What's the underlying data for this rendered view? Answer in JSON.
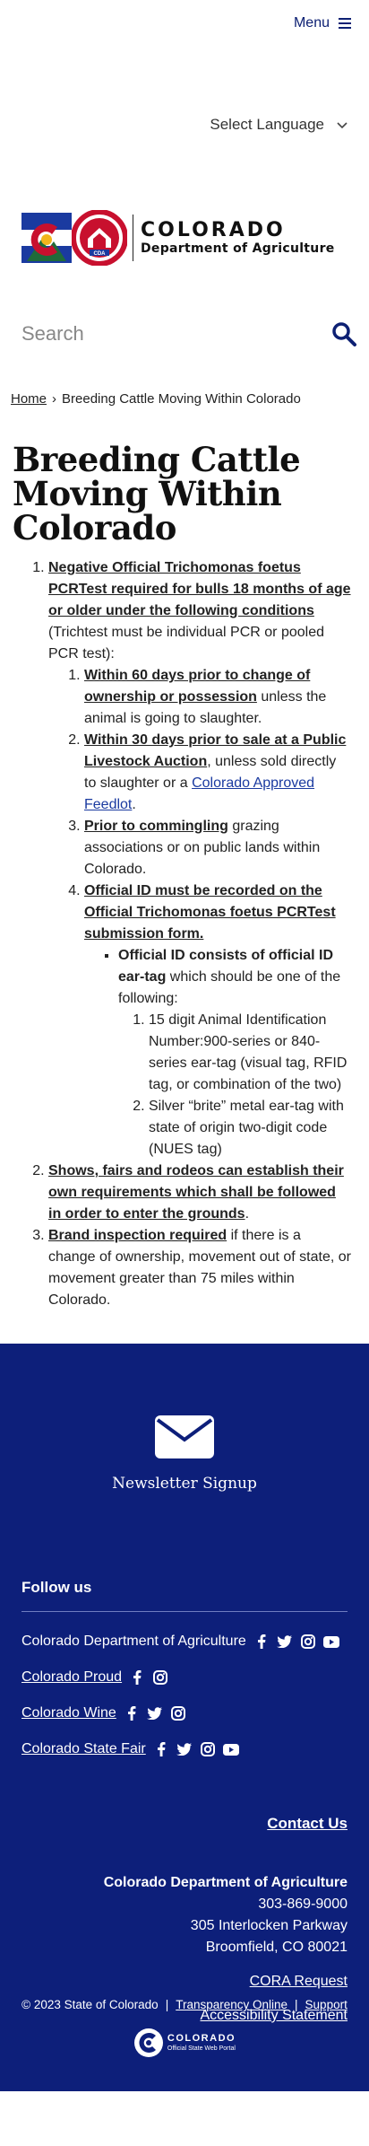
{
  "header": {
    "menu_label": "Menu",
    "language_label": "Select Language"
  },
  "logo": {
    "state": "COLORADO",
    "department": "Department of Agriculture",
    "badge": "CDA"
  },
  "search": {
    "placeholder": "Search"
  },
  "breadcrumb": {
    "home": "Home",
    "separator": "›",
    "current": "Breeding Cattle Moving Within Colorado"
  },
  "page": {
    "title": "Breeding Cattle Moving Within Colorado"
  },
  "content": {
    "item1": {
      "bold": "Negative Official Trichomonas foetus PCRTest required for bulls 18 months of age or older under the following conditions",
      "rest": " (Trichtest must be individual PCR or pooled PCR test):",
      "sub": [
        {
          "bold": "Within 60 days prior to change of ownership or possession",
          "rest": " unless the animal is going to slaughter."
        },
        {
          "bold": "Within 30 days prior to sale at a Public Livestock Auction",
          "rest": ", unless sold directly to slaughter or a ",
          "link": "Colorado Approved Feedlot",
          "tail": "."
        },
        {
          "bold": "Prior to commingling",
          "rest": " grazing associations or on public lands within Colorado."
        },
        {
          "bold": "Official ID must be recorded on the Official Trichomonas foetus PCRTest submission form."
        }
      ],
      "id_point": {
        "bold": "Official ID consists of official ID ear-tag",
        "rest": " which should be one of the following:",
        "options": [
          "15 digit Animal Identification Number:900-series or 840-series ear-tag (visual tag, RFID tag, or combination of the two)",
          "Silver “brite” metal ear-tag with state of origin two-digit code (NUES tag)"
        ]
      }
    },
    "item2": {
      "bold": "Shows, fairs and rodeos can establish their own requirements which shall be followed in order to enter the grounds",
      "rest": "."
    },
    "item3": {
      "bold": "Brand inspection required",
      "rest": " if there is a change of ownership, movement out of state, or movement greater than 75 miles within Colorado."
    }
  },
  "footer": {
    "newsletter_label": "Newsletter Signup",
    "follow_heading": "Follow us",
    "social": [
      {
        "name": "Colorado Department of Agriculture",
        "icons": [
          "facebook-icon",
          "twitter-icon",
          "instagram-icon",
          "youtube-icon"
        ]
      },
      {
        "name": "Colorado Proud",
        "icons": [
          "facebook-icon",
          "instagram-icon"
        ]
      },
      {
        "name": "Colorado Wine",
        "icons": [
          "facebook-icon",
          "twitter-icon",
          "instagram-icon"
        ]
      },
      {
        "name": "Colorado State Fair",
        "icons": [
          "facebook-icon",
          "twitter-icon",
          "instagram-icon",
          "youtube-icon"
        ]
      }
    ],
    "contact_us": "Contact Us",
    "org_name": "Colorado Department of Agriculture",
    "phone": "303-869-9000",
    "address1": "305 Interlocken Parkway",
    "address2": "Broomfield, CO 80021",
    "cora": "CORA Request",
    "accessibility": "Accessibility Statement",
    "copyright": "© 2023 State of Colorado",
    "pipe": "|",
    "transparency": "Transparency Online",
    "support": "Support",
    "portal_name": "COLORADO",
    "portal_sub": "Official State Web Portal"
  },
  "colors": {
    "brand_navy": "#0d1f7a",
    "accent_red": "#c8102e",
    "accent_gold": "#f2b51c"
  }
}
